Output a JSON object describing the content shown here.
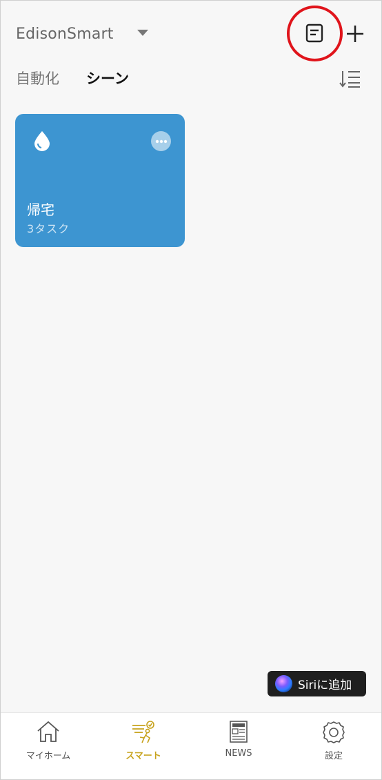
{
  "header": {
    "home_name": "EdisonSmart",
    "icons": {
      "dropdown": "caret-down-icon",
      "log": "document-icon",
      "add": "plus-icon"
    }
  },
  "tabs": [
    {
      "label": "自動化",
      "active": false
    },
    {
      "label": "シーン",
      "active": true
    }
  ],
  "sort_icon": "sort-icon",
  "scenes": [
    {
      "name": "帰宅",
      "tasks": "3タスク",
      "icon": "water-drop-icon",
      "color": "#3d95d1"
    }
  ],
  "siri": {
    "label": "Siriに追加"
  },
  "tabbar": {
    "items": [
      {
        "label": "マイホーム",
        "icon": "home-icon",
        "active": false
      },
      {
        "label": "スマート",
        "icon": "smart-icon",
        "active": true
      },
      {
        "label": "NEWS",
        "icon": "news-icon",
        "active": false
      },
      {
        "label": "設定",
        "icon": "gear-icon",
        "active": false
      }
    ],
    "active_color": "#c7a21b"
  },
  "highlight_color": "#e0141b"
}
